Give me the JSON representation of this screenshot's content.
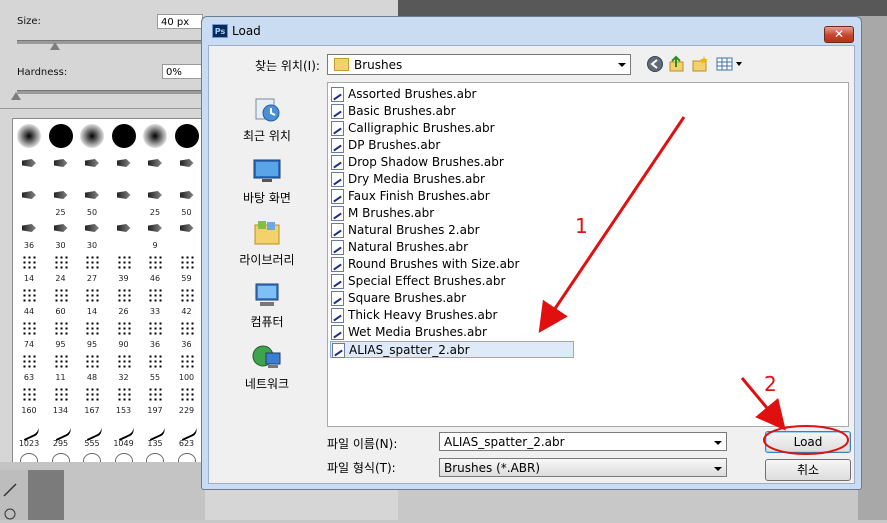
{
  "background_panel": {
    "size_label": "Size:",
    "size_value": "40 px",
    "hardness_label": "Hardness:",
    "hardness_value": "0%",
    "brush_rows": [
      [
        "",
        "",
        "",
        "",
        "",
        ""
      ],
      [
        "",
        "",
        "",
        "",
        "",
        ""
      ],
      [
        "",
        "25",
        "50",
        "",
        "25",
        "50"
      ],
      [
        "36",
        "30",
        "30",
        "",
        "9",
        ""
      ],
      [
        "14",
        "24",
        "27",
        "39",
        "46",
        "59"
      ],
      [
        "44",
        "60",
        "14",
        "26",
        "33",
        "42"
      ],
      [
        "74",
        "95",
        "95",
        "90",
        "36",
        "36"
      ],
      [
        "63",
        "11",
        "48",
        "32",
        "55",
        "100"
      ],
      [
        "160",
        "134",
        "167",
        "153",
        "197",
        "229"
      ],
      [
        "1023",
        "295",
        "555",
        "1049",
        "135",
        "623"
      ],
      [
        "",
        "",
        "",
        "",
        "",
        ""
      ]
    ]
  },
  "dialog": {
    "app_icon": "Ps",
    "title": "Load",
    "close_label": "✕",
    "look_in_label": "찾는 위치(I):",
    "look_in_value": "Brushes",
    "places": [
      {
        "label": "최근 위치",
        "icon": "recent-places-icon"
      },
      {
        "label": "바탕 화면",
        "icon": "desktop-icon"
      },
      {
        "label": "라이브러리",
        "icon": "libraries-icon"
      },
      {
        "label": "컴퓨터",
        "icon": "computer-icon"
      },
      {
        "label": "네트워크",
        "icon": "network-icon"
      }
    ],
    "files": [
      "Assorted Brushes.abr",
      "Basic Brushes.abr",
      "Calligraphic Brushes.abr",
      "DP Brushes.abr",
      "Drop Shadow Brushes.abr",
      "Dry Media Brushes.abr",
      "Faux Finish Brushes.abr",
      "M Brushes.abr",
      "Natural Brushes 2.abr",
      "Natural Brushes.abr",
      "Round Brushes with Size.abr",
      "Special Effect Brushes.abr",
      "Square Brushes.abr",
      "Thick Heavy Brushes.abr",
      "Wet Media Brushes.abr",
      "ALIAS_spatter_2.abr"
    ],
    "selected_file": "ALIAS_spatter_2.abr",
    "filename_label": "파일 이름(N):",
    "filename_value": "ALIAS_spatter_2.abr",
    "filetype_label": "파일 형식(T):",
    "filetype_value": "Brushes (*.ABR)",
    "load_button": "Load",
    "cancel_button": "취소"
  },
  "annotations": {
    "step1": "1",
    "step2": "2",
    "color": "#e01010"
  }
}
